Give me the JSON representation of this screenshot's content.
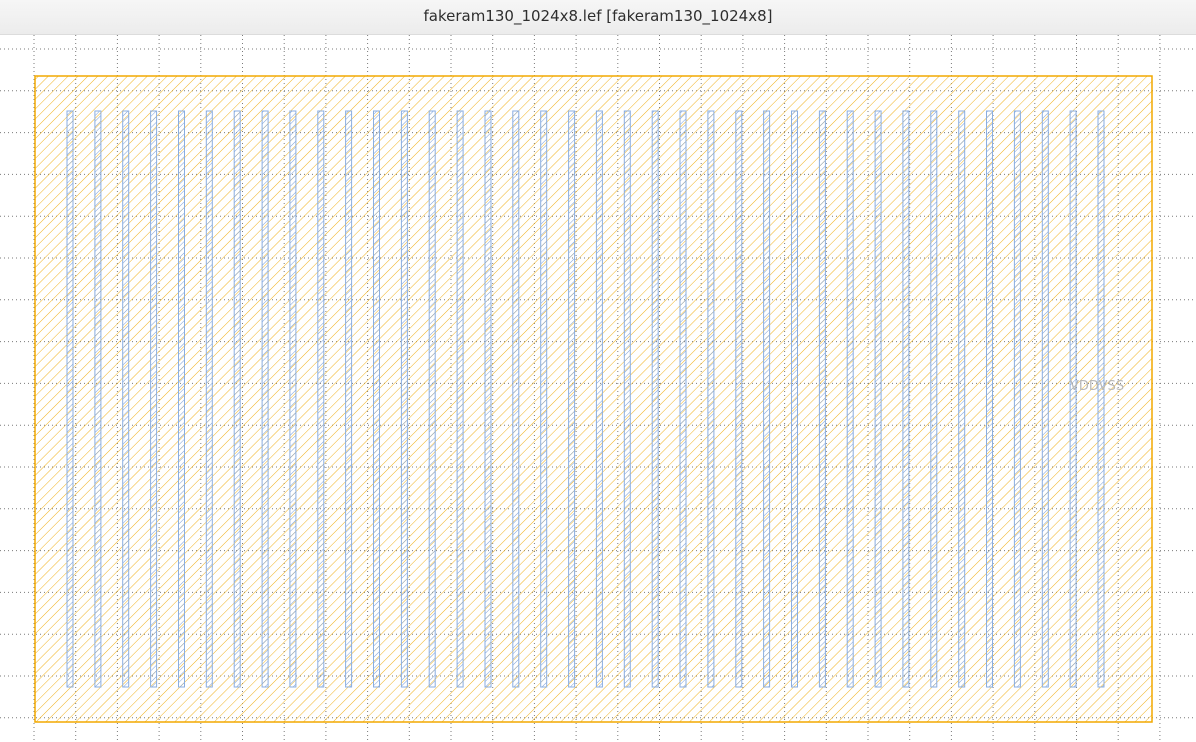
{
  "window": {
    "title": "fakeram130_1024x8.lef [fakeram130_1024x8]"
  },
  "layout_view": {
    "pin_label": "VDDVSS",
    "stripe_count": 38,
    "colors": {
      "boundary": "#f2a900",
      "boundary_hatch": "#f0b21f",
      "stripe": "#8aaee0",
      "stripe_hatch": "#7a9fd8",
      "grid_dot": "#7a7a7a",
      "label": "#b8b8b8"
    }
  }
}
